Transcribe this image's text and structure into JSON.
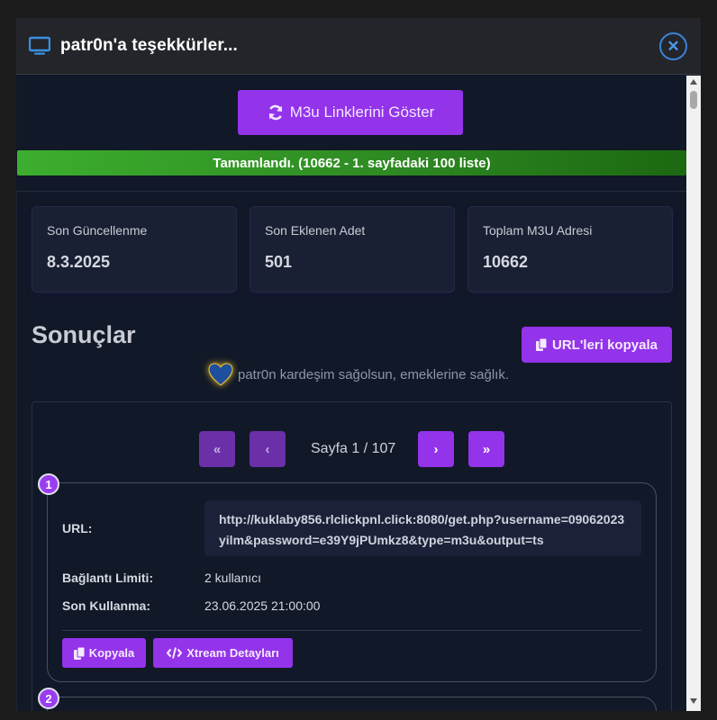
{
  "modal": {
    "title": "patr0n'a teşekkürler...",
    "close_label": "✕"
  },
  "toolbar": {
    "show_links_label": "M3u Linklerini Göster"
  },
  "progress": {
    "text": "Tamamlandı. (10662 - 1. sayfadaki 100 liste)",
    "percent": 100,
    "color": "#2e8a22"
  },
  "stats": [
    {
      "label": "Son Güncellenme",
      "value": "8.3.2025"
    },
    {
      "label": "Son Eklenen Adet",
      "value": "501"
    },
    {
      "label": "Toplam M3U Adresi",
      "value": "10662"
    }
  ],
  "results": {
    "title": "Sonuçlar",
    "copy_urls_label": "URL'leri kopyala",
    "thanks_text": "patr0n kardeşim sağolsun, emeklerine sağlık."
  },
  "pager": {
    "first_label": "«",
    "prev_label": "‹",
    "next_label": "›",
    "last_label": "»",
    "info": "Sayfa 1 / 107"
  },
  "items": [
    {
      "index": "1",
      "url_label": "URL:",
      "url": "http://kuklaby856.rlclickpnl.click:8080/get.php?username=09062023yilm&password=e39Y9jPUmkz8&type=m3u&output=ts",
      "limit_label": "Bağlantı Limiti:",
      "limit": "2 kullanıcı",
      "expiry_label": "Son Kullanma:",
      "expiry": "23.06.2025 21:00:00",
      "copy_label": "Kopyala",
      "xtream_label": "Xtream Detayları"
    },
    {
      "index": "2"
    }
  ],
  "colors": {
    "accent": "#9333ea",
    "background": "#111827",
    "close_blue": "#3b82d6"
  }
}
